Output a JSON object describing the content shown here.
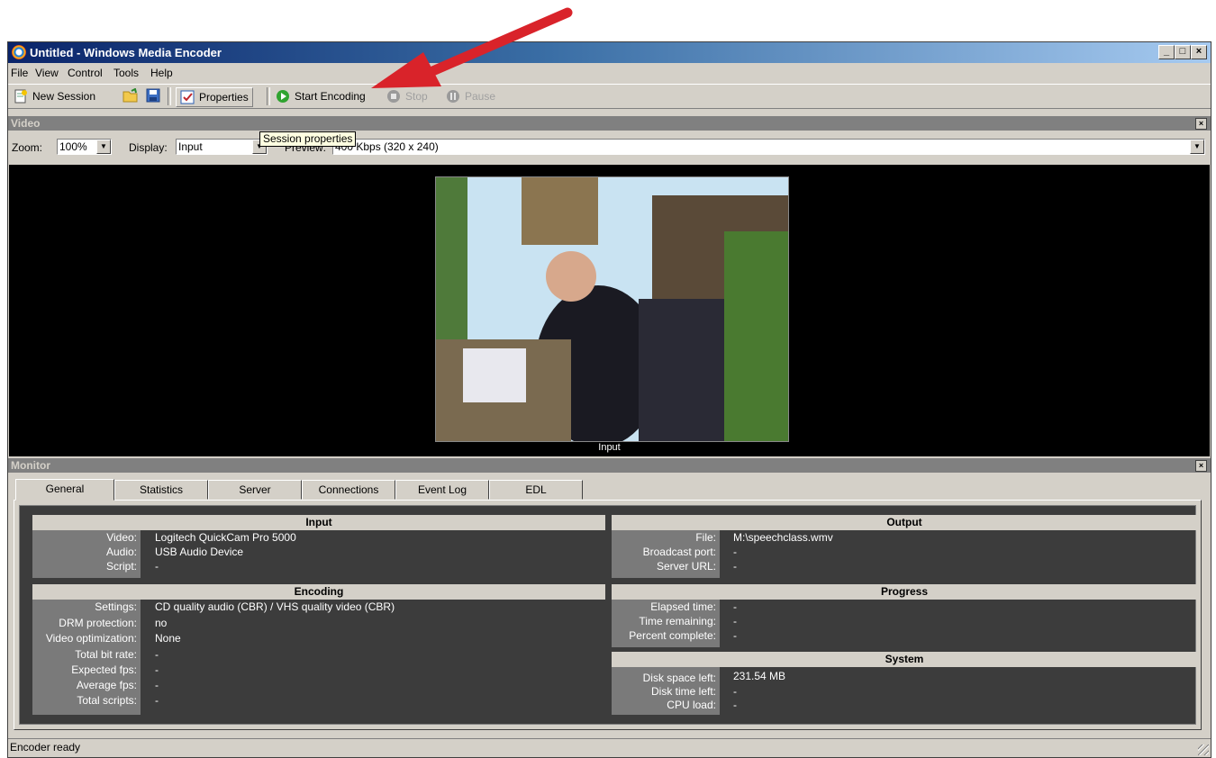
{
  "window": {
    "title": "Untitled - Windows Media Encoder"
  },
  "menu": [
    "File",
    "View",
    "Control",
    "Tools",
    "Help"
  ],
  "toolbar": {
    "new_session": "New Session",
    "properties": "Properties",
    "start_encoding": "Start Encoding",
    "stop": "Stop",
    "pause": "Pause",
    "tooltip": "Session properties"
  },
  "video_panel": {
    "title": "Video",
    "zoom_label": "Zoom:",
    "zoom_value": "100%",
    "display_label": "Display:",
    "display_value": "Input",
    "preview_label": "Preview:",
    "preview_value": "400 Kbps (320 x 240)",
    "caption": "Input"
  },
  "monitor_panel": {
    "title": "Monitor",
    "tabs": [
      "General",
      "Statistics",
      "Server",
      "Connections",
      "Event Log",
      "EDL"
    ],
    "input": {
      "title": "Input",
      "rows": [
        {
          "label": "Video:",
          "value": "Logitech QuickCam Pro 5000"
        },
        {
          "label": "Audio:",
          "value": "USB Audio Device"
        },
        {
          "label": "Script:",
          "value": "-"
        }
      ]
    },
    "encoding": {
      "title": "Encoding",
      "rows": [
        {
          "label": "Settings:",
          "value": "CD quality audio (CBR) / VHS quality video (CBR)"
        },
        {
          "label": "DRM protection:",
          "value": "no"
        },
        {
          "label": "Video optimization:",
          "value": "None"
        },
        {
          "label": "Total bit rate:",
          "value": "-"
        },
        {
          "label": "Expected fps:",
          "value": "-"
        },
        {
          "label": "Average fps:",
          "value": "-"
        },
        {
          "label": "Total scripts:",
          "value": "-"
        }
      ]
    },
    "output": {
      "title": "Output",
      "rows": [
        {
          "label": "File:",
          "value": "M:\\speechclass.wmv"
        },
        {
          "label": "Broadcast port:",
          "value": "-"
        },
        {
          "label": "Server URL:",
          "value": "-"
        }
      ]
    },
    "progress": {
      "title": "Progress",
      "rows": [
        {
          "label": "Elapsed time:",
          "value": "-"
        },
        {
          "label": "Time remaining:",
          "value": "-"
        },
        {
          "label": "Percent complete:",
          "value": "-"
        }
      ]
    },
    "system": {
      "title": "System",
      "rows": [
        {
          "label": "Disk space left:",
          "value": "231.54 MB"
        },
        {
          "label": "Disk time left:",
          "value": "-"
        },
        {
          "label": "CPU load:",
          "value": "-"
        }
      ]
    }
  },
  "status": {
    "text": "Encoder ready"
  },
  "colors": {
    "annotation_arrow": "#d9232a",
    "titlebar_start": "#0a246a",
    "titlebar_end": "#a6caf0"
  }
}
